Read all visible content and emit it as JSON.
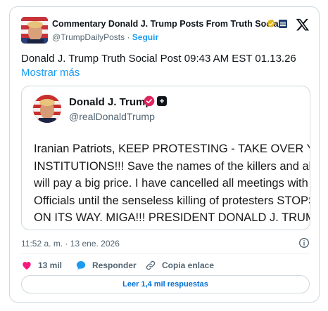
{
  "header": {
    "account_name": "Commentary Donald J. Trump Posts From Truth Social",
    "handle": "@TrumpDailyPosts",
    "separator": "·",
    "follow_label": "Seguir",
    "flag_badge_text": "🇺🇸",
    "icons": [
      "verified-gold-icon",
      "flag-badge-icon",
      "x-logo-icon"
    ]
  },
  "tweet": {
    "text": "Donald J. Trump Truth Social Post 09:43 AM EST 01.13.26",
    "more_label": "Mostrar más"
  },
  "embed": {
    "name": "Donald J. Trump",
    "handle": "@realDonaldTrump",
    "plus_label": "+",
    "lines": [
      "Iranian Patriots, KEEP PROTESTING - TAKE OVER YOUR",
      "INSTITUTIONS!!! Save the names of the killers and abusers. They",
      "will pay a big price. I have cancelled all meetings with Iranian",
      "Officials until the senseless killing of protesters STOPS. HELP IS",
      "ON ITS WAY. MIGA!!! PRESIDENT DONALD J. TRUMP"
    ]
  },
  "meta": {
    "timestamp": "11:52 a. m. · 13 ene. 2026"
  },
  "actions": {
    "likes_count": "13 mil",
    "reply_label": "Responder",
    "copy_label": "Copia enlace"
  },
  "replies_button": {
    "label": "Leer 1,4 mil respuestas"
  },
  "colors": {
    "accent": "#1d9bf0",
    "like": "#f91880",
    "link_button": "#006fd6",
    "muted": "#536471",
    "border": "#cfd9de"
  }
}
